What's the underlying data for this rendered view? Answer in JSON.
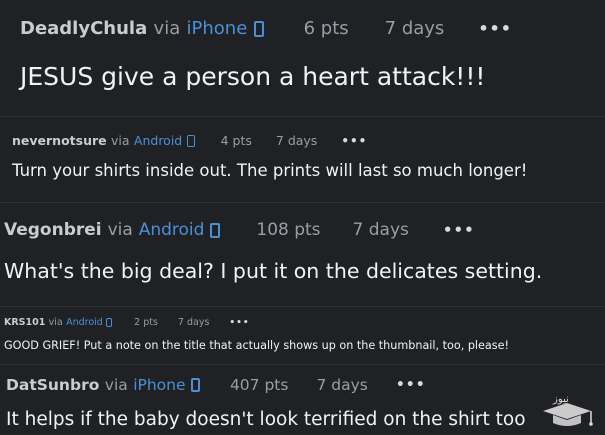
{
  "comments": [
    {
      "username": "DeadlyChula",
      "via": "via",
      "platform": "iPhone",
      "platform_icon": "phone-device-icon",
      "points": "6 pts",
      "age": "7 days",
      "more": "•••",
      "text": "JESUS give a person a heart attack!!!"
    },
    {
      "username": "nevernotsure",
      "via": "via",
      "platform": "Android",
      "platform_icon": "phone-device-icon",
      "points": "4 pts",
      "age": "7 days",
      "more": "•••",
      "text": "Turn your shirts inside out. The prints will last so much longer!"
    },
    {
      "username": "Vegonbrei",
      "via": "via",
      "platform": "Android",
      "platform_icon": "phone-device-icon",
      "points": "108 pts",
      "age": "7 days",
      "more": "•••",
      "text": "What's the big deal? I put it on the delicates setting."
    },
    {
      "username": "KRS101",
      "via": "via",
      "platform": "Android",
      "platform_icon": "phone-device-icon",
      "points": "2 pts",
      "age": "7 days",
      "more": "•••",
      "text": "GOOD GRIEF! Put a note on the title that actually shows up on the thumbnail, too, please!"
    },
    {
      "username": "DatSunbro",
      "via": "via",
      "platform": "iPhone",
      "platform_icon": "phone-device-icon",
      "points": "407 pts",
      "age": "7 days",
      "more": "•••",
      "text": "It helps if the baby doesn't look terrified on the shirt too"
    }
  ],
  "watermark": {
    "text": "نیوز",
    "icon": "graduation-cap-logo-icon"
  },
  "colors": {
    "background": "#1b1d20",
    "text": "#f1f2f4",
    "meta": "#9a9da3",
    "platform_link": "#4a90d9"
  }
}
